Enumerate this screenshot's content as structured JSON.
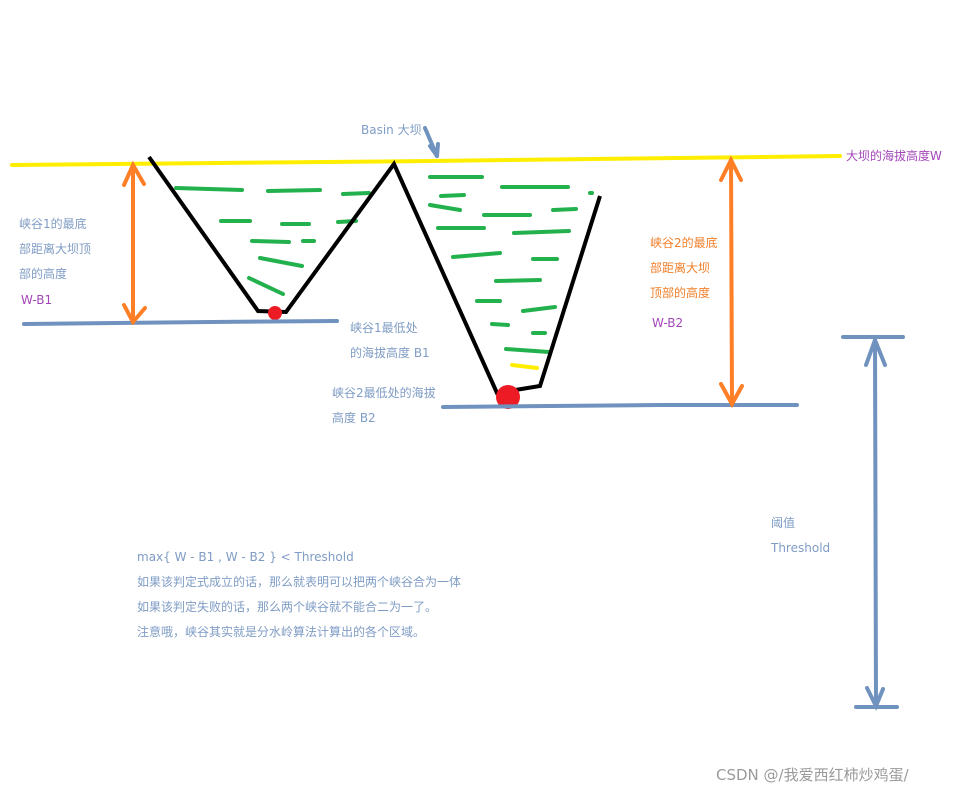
{
  "colors": {
    "dam_line": "#ffee00",
    "valley_wall": "#000000",
    "water": "#22b14c",
    "minimum_point": "#ed1c24",
    "baseline": "#7092be",
    "height_arrow": "#ff7f27",
    "threshold_arrow": "#7092be"
  },
  "labels": {
    "basin_dam": "Basin 大坝",
    "dam_height_w": "大坝的海拔高度W",
    "valley1_height": [
      "峡谷1的最底",
      "部距离大坝顶",
      "部的高度"
    ],
    "valley1_formula": "W-B1",
    "valley2_height": [
      "峡谷2的最底",
      "部距离大坝",
      "顶部的高度"
    ],
    "valley2_formula": "W-B2",
    "valley1_min": [
      "峡谷1最低处",
      "的海拔高度 B1"
    ],
    "valley2_min": [
      "峡谷2最低处的海拔",
      "高度  B2"
    ],
    "threshold": [
      "阈值",
      "Threshold"
    ]
  },
  "explanation": [
    "max{ W - B1 , W - B2 } < Threshold",
    "如果该判定式成立的话，那么就表明可以把两个峡谷合为一体",
    "如果该判定失败的话，那么两个峡谷就不能合二为一了。",
    "注意哦，峡谷其实就是分水岭算法计算出的各个区域。"
  ],
  "watermark": "CSDN @/我爱西红柿炒鸡蛋/"
}
